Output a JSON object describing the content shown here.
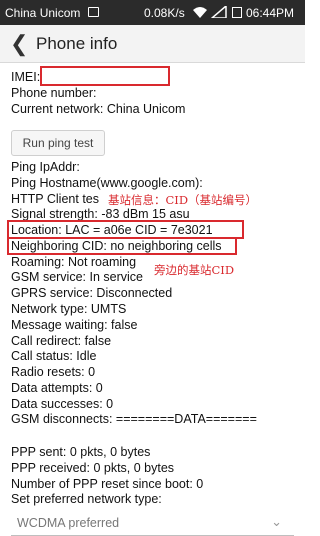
{
  "status_bar": {
    "carrier": "China Unicom",
    "speed": "0.08K/s",
    "time": "06:44PM"
  },
  "header": {
    "title": "Phone info"
  },
  "info": {
    "imei_label": "IMEI:",
    "phone_number": "Phone number:",
    "current_network": "Current network: China Unicom"
  },
  "ping_button": "Run ping test",
  "details": [
    "Ping IpAddr:",
    "Ping Hostname(www.google.com):",
    "HTTP Client tes",
    "Signal strength: -83 dBm   15 asu",
    "Location: LAC = a06e   CID = 7e3021",
    "Neighboring CID: no neighboring cells",
    "Roaming: Not roaming",
    "GSM service: In service",
    "GPRS service: Disconnected",
    "Network type: UMTS",
    "Message waiting: false",
    "Call redirect: false",
    "Call status: Idle",
    "Radio resets: 0",
    "Data attempts: 0",
    "Data successes: 0",
    "GSM disconnects: ========DATA======="
  ],
  "ppp": [
    "PPP sent: 0 pkts, 0 bytes",
    "PPP received: 0 pkts, 0 bytes",
    "Number of PPP reset since boot: 0",
    "Set preferred network type:"
  ],
  "preferred_network": {
    "value": "WCDMA preferred"
  },
  "annotations": {
    "base_station": "基站信息：CID（基站编号）",
    "neighbor": "旁边的基站CID"
  },
  "colors": {
    "highlight": "#d9292e",
    "status_bar": "#2b2b2b"
  }
}
